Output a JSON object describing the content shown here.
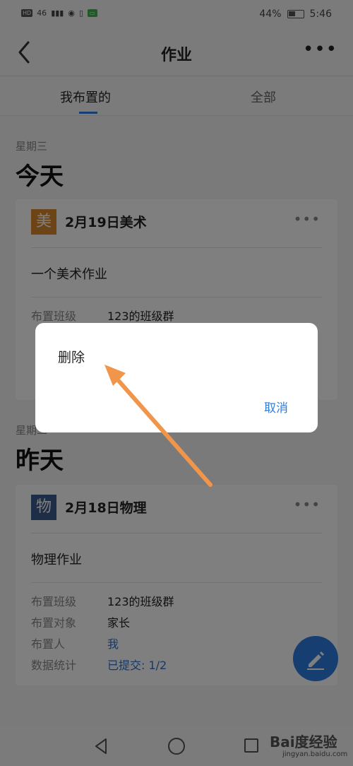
{
  "status_bar": {
    "left_chips": [
      "HD",
      "46"
    ],
    "battery_percent": "44%",
    "time": "5:46"
  },
  "header": {
    "title": "作业",
    "back_icon": "chevron-left-icon",
    "more_icon": "more-horizontal-icon"
  },
  "tabs": [
    {
      "label": "我布置的",
      "active": true
    },
    {
      "label": "全部",
      "active": false
    }
  ],
  "sections": [
    {
      "weekday": "星期三",
      "day": "今天",
      "card": {
        "icon_char": "美",
        "icon_color": "#d9892a",
        "title": "2月19日美术",
        "description": "一个美术作业",
        "rows": [
          {
            "key": "布置班级",
            "value": "123的班级群"
          }
        ]
      }
    },
    {
      "weekday": "星期二",
      "day": "昨天",
      "card": {
        "icon_char": "物",
        "icon_color": "#3d5c8c",
        "title": "2月18日物理",
        "description": "物理作业",
        "rows": [
          {
            "key": "布置班级",
            "value": "123的班级群"
          },
          {
            "key": "布置对象",
            "value": "家长"
          },
          {
            "key": "布置人",
            "value": "我"
          },
          {
            "key": "数据统计",
            "value": "已提交: 1/2"
          }
        ]
      }
    }
  ],
  "dialog": {
    "item": "删除",
    "cancel": "取消"
  },
  "watermark": {
    "brand": "Bai度经验",
    "url": "jingyan.baidu.com"
  },
  "colors": {
    "accent": "#2f7de1",
    "annotation_arrow": "#f0954a"
  }
}
